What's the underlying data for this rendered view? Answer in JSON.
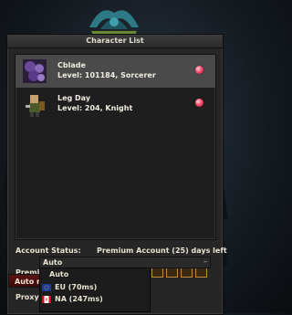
{
  "window": {
    "title": "Character List"
  },
  "characters": [
    {
      "name": "Cblade",
      "info": "Level: 101184, Sorcerer",
      "selected": true
    },
    {
      "name": "Leg Day",
      "info": "Level: 204, Knight",
      "selected": false
    }
  ],
  "account": {
    "status_label": "Account Status:",
    "status_value": "Premium Account (25) days left",
    "benefits_label": "Premium Benefits:"
  },
  "proxy": {
    "label": "Proxy:",
    "selected": "Auto",
    "options": [
      {
        "label": "Auto"
      },
      {
        "label": "EU (70ms)",
        "flag": "eu"
      },
      {
        "label": "NA (247ms)",
        "flag": "ca"
      }
    ]
  },
  "auto_button": {
    "label": "Auto r"
  },
  "colors": {
    "online_dot": "#ff5070",
    "selected_row": "#4a4a4a",
    "button": "#5a1414",
    "benefit_border": "#c08a30"
  },
  "icons": [
    "ornament-icon",
    "character-portrait-icon",
    "status-dot-icon",
    "premium-benefit-icon",
    "chevron-down-icon",
    "eu-flag-icon",
    "canada-flag-icon"
  ]
}
